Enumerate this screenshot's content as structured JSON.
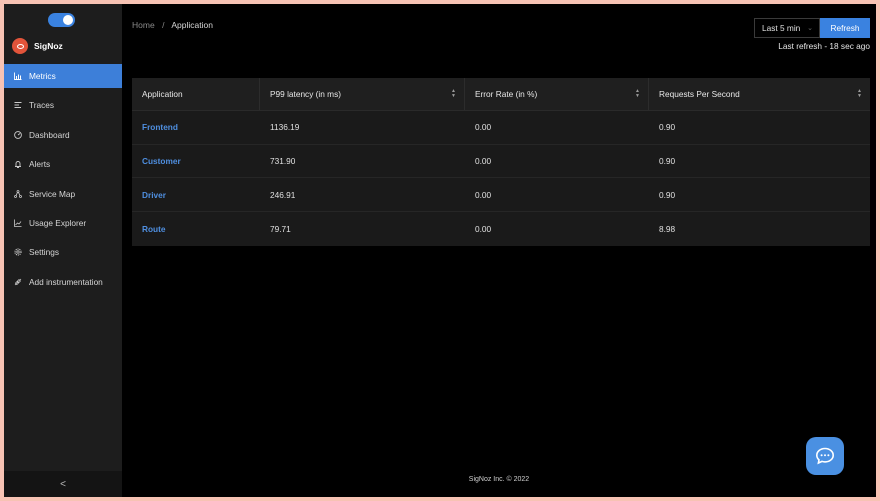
{
  "brand": {
    "name": "SigNoz"
  },
  "sidebar": {
    "items": [
      {
        "label": "Metrics",
        "icon": "bar-chart-icon",
        "active": true
      },
      {
        "label": "Traces",
        "icon": "traces-icon"
      },
      {
        "label": "Dashboard",
        "icon": "dashboard-icon"
      },
      {
        "label": "Alerts",
        "icon": "alert-icon"
      },
      {
        "label": "Service Map",
        "icon": "service-map-icon"
      },
      {
        "label": "Usage Explorer",
        "icon": "line-chart-icon"
      },
      {
        "label": "Settings",
        "icon": "gear-icon"
      },
      {
        "label": "Add instrumentation",
        "icon": "api-icon"
      }
    ],
    "collapse_label": "<"
  },
  "breadcrumb": {
    "home": "Home",
    "separator": "/",
    "current": "Application"
  },
  "toolbar": {
    "time_range": "Last 5 min",
    "refresh_label": "Refresh",
    "last_refresh": "Last refresh - 18 sec ago"
  },
  "table": {
    "columns": [
      "Application",
      "P99 latency (in ms)",
      "Error Rate (in %)",
      "Requests Per Second"
    ],
    "rows": [
      {
        "application": "Frontend",
        "p99": "1136.19",
        "error_rate": "0.00",
        "rps": "0.90"
      },
      {
        "application": "Customer",
        "p99": "731.90",
        "error_rate": "0.00",
        "rps": "0.90"
      },
      {
        "application": "Driver",
        "p99": "246.91",
        "error_rate": "0.00",
        "rps": "0.90"
      },
      {
        "application": "Route",
        "p99": "79.71",
        "error_rate": "0.00",
        "rps": "8.98"
      }
    ]
  },
  "footer": {
    "text": "SigNoz Inc. © 2022"
  },
  "colors": {
    "accent": "#3d7fd9",
    "link": "#4f8fe0",
    "brand": "#e2543a"
  }
}
